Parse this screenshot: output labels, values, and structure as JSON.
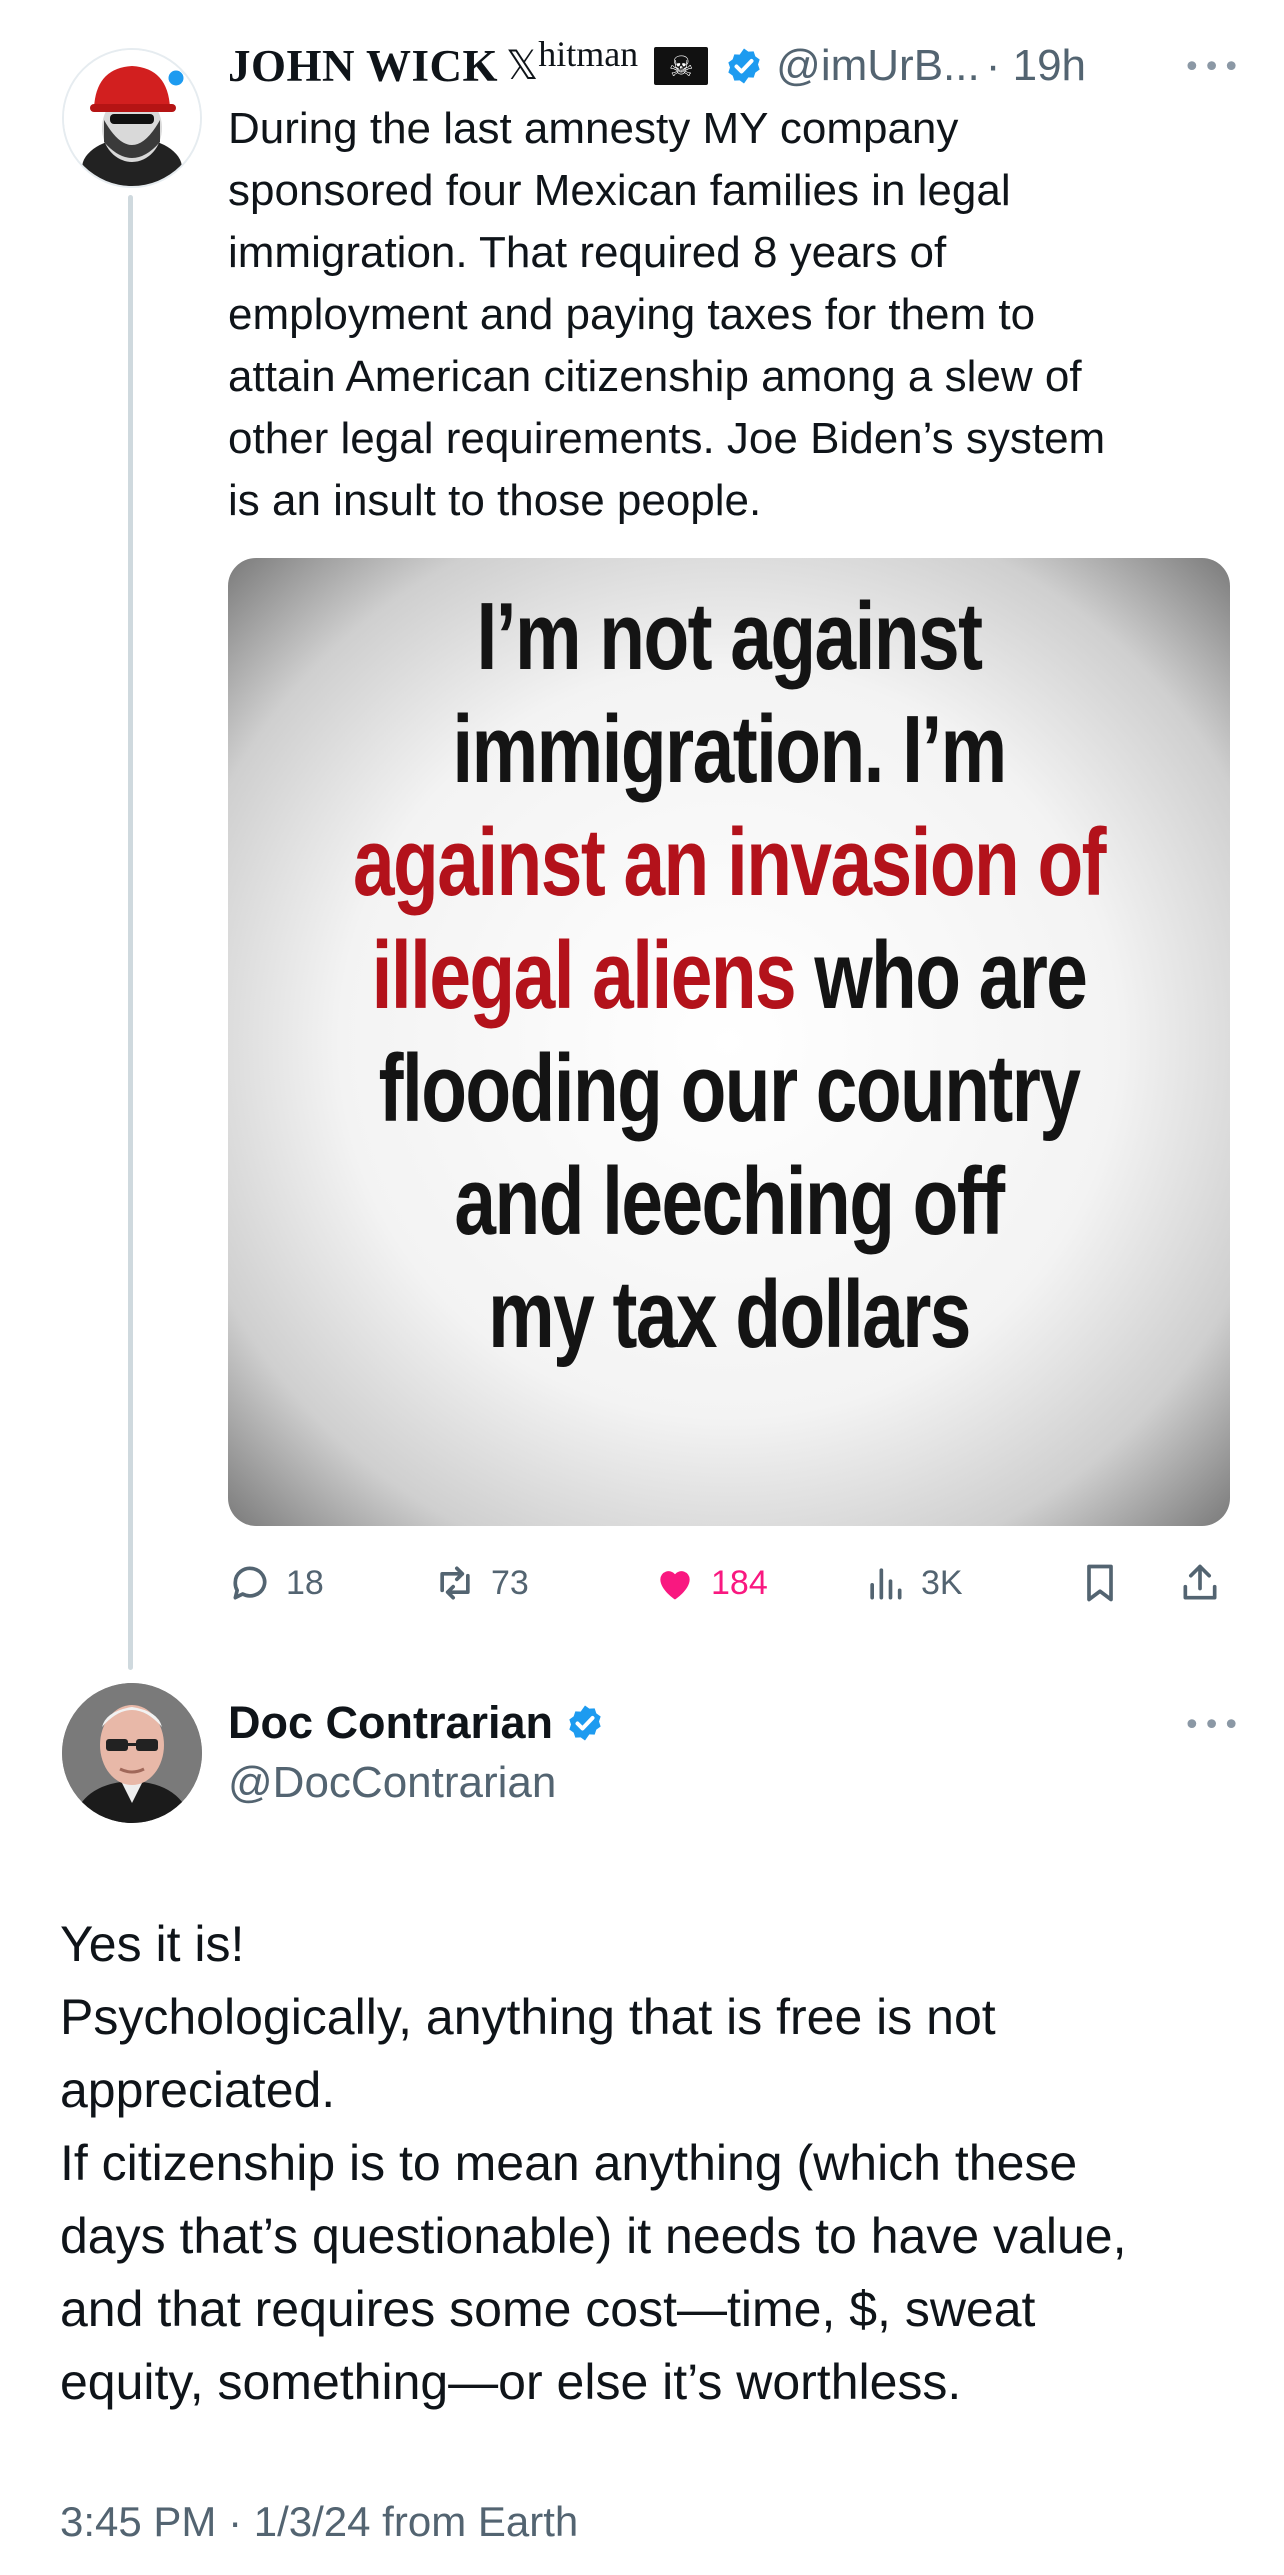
{
  "tweet": {
    "author": {
      "display_name": "JOHN WICK",
      "x_glyph": "𝕏",
      "suffix": "hitman",
      "flag_icon": "pirate-flag-icon",
      "verified": true,
      "handle": "@imUrB...",
      "time": "· 19h"
    },
    "text": "During the last amnesty MY company\nsponsored four Mexican families in legal\nimmigration.  That required 8 years of\nemployment and paying taxes for them to\nattain American citizenship among a slew of\nother legal requirements.  Joe Biden’s system\nis an insult to those people.",
    "media_lines": [
      {
        "text": "I’m not against",
        "color": "dark"
      },
      {
        "text": "immigration. I’m",
        "color": "dark"
      },
      {
        "text": "against an invasion of",
        "color": "red"
      },
      {
        "text": "illegal aliens who are",
        "color": "mixed"
      },
      {
        "text": "flooding our country",
        "color": "dark"
      },
      {
        "text": "and leeching off",
        "color": "dark"
      },
      {
        "text": "my tax dollars",
        "color": "dark"
      }
    ],
    "media_line4_red": "illegal aliens ",
    "media_line4_dark": "who are",
    "actions": {
      "replies": "18",
      "reposts": "73",
      "likes": "184",
      "views": "3K"
    },
    "more_icon": "more-horizontal-icon"
  },
  "reply": {
    "display_name": "Doc Contrarian",
    "handle": "@DocContrarian",
    "verified": true,
    "text": "Yes it is!\nPsychologically, anything that is free is not\nappreciated.\nIf citizenship is to mean anything (which these\ndays that’s questionable) it needs to have value,\nand that requires some cost—time, $, sweat\nequity, something—or else it’s worthless.",
    "timestamp": "3:45 PM · 1/3/24 from Earth"
  },
  "colors": {
    "text": "#0f1419",
    "secondary": "#536471",
    "verified": "#1d9bf0",
    "like": "#f91880",
    "thread_line": "#cfd9de",
    "poster_red": "#b3121b"
  }
}
